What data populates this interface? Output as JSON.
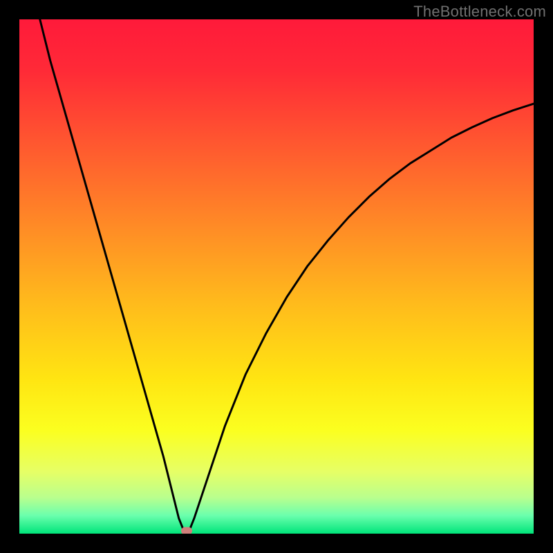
{
  "attribution": "TheBottleneck.com",
  "colors": {
    "background": "#000000",
    "curve": "#000000",
    "marker": "#cf7f7b",
    "gradient_stops": [
      {
        "offset": 0.0,
        "color": "#ff1a3a"
      },
      {
        "offset": 0.1,
        "color": "#ff2a37"
      },
      {
        "offset": 0.25,
        "color": "#ff5a2f"
      },
      {
        "offset": 0.4,
        "color": "#ff8a26"
      },
      {
        "offset": 0.55,
        "color": "#ffba1c"
      },
      {
        "offset": 0.7,
        "color": "#ffe512"
      },
      {
        "offset": 0.8,
        "color": "#fbff20"
      },
      {
        "offset": 0.88,
        "color": "#e6ff66"
      },
      {
        "offset": 0.93,
        "color": "#b9ff8e"
      },
      {
        "offset": 0.965,
        "color": "#6affad"
      },
      {
        "offset": 1.0,
        "color": "#00e57a"
      }
    ]
  },
  "chart_data": {
    "type": "line",
    "title": "",
    "xlabel": "",
    "ylabel": "",
    "xlim": [
      0,
      100
    ],
    "ylim": [
      0,
      100
    ],
    "grid": false,
    "legend": false,
    "series": [
      {
        "name": "bottleneck-curve",
        "x": [
          4,
          6,
          8,
          10,
          12,
          14,
          16,
          18,
          20,
          22,
          24,
          26,
          28,
          30,
          31,
          32,
          33,
          34,
          36,
          38,
          40,
          44,
          48,
          52,
          56,
          60,
          64,
          68,
          72,
          76,
          80,
          84,
          88,
          92,
          96,
          100
        ],
        "y": [
          100,
          92,
          85,
          78,
          71,
          64,
          57,
          50,
          43,
          36,
          29,
          22,
          15,
          7,
          3,
          0.5,
          0.5,
          3,
          9,
          15,
          21,
          31,
          39,
          46,
          52,
          57,
          61.5,
          65.5,
          69,
          72,
          74.5,
          77,
          79,
          80.8,
          82.3,
          83.6
        ]
      }
    ],
    "marker": {
      "x": 32.5,
      "y": 0.5
    }
  }
}
